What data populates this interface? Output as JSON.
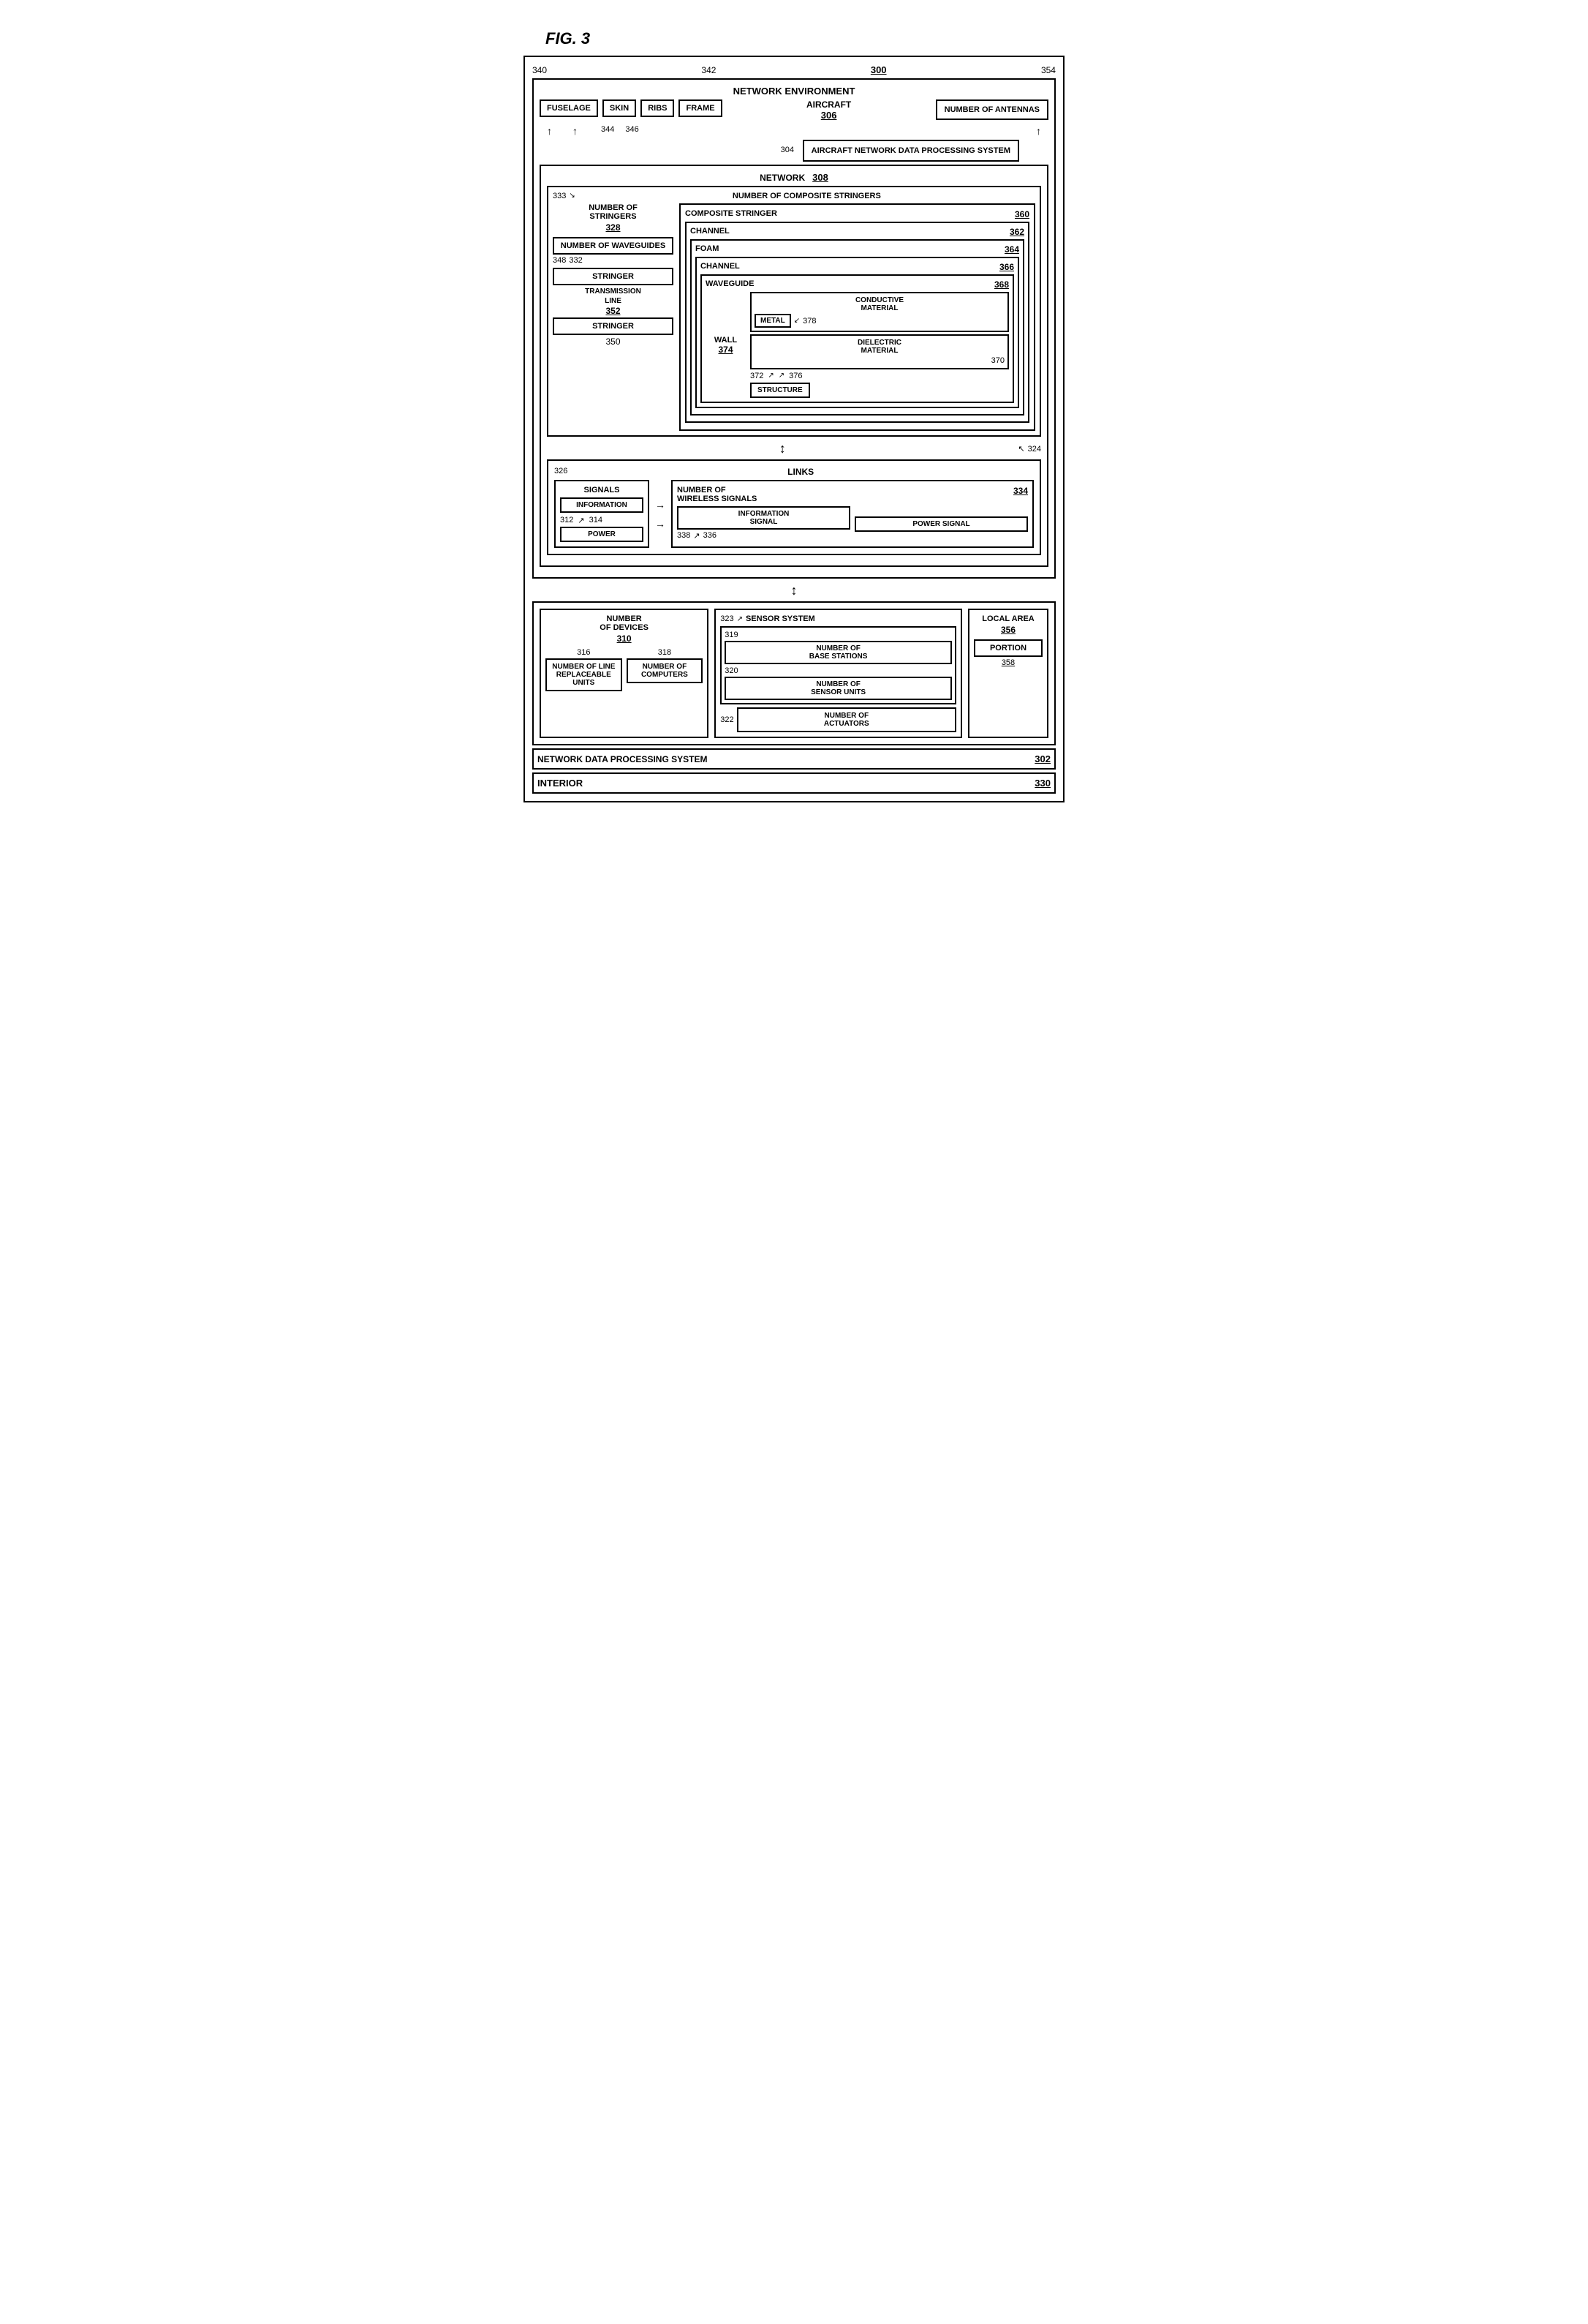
{
  "fig": {
    "title": "FIG. 3"
  },
  "refs": {
    "r300": "300",
    "r302": "302",
    "r304": "304",
    "r306": "306",
    "r308": "308",
    "r310": "310",
    "r312": "312",
    "r314": "314",
    "r316": "316",
    "r318": "318",
    "r319": "319",
    "r320": "320",
    "r322": "322",
    "r323": "323",
    "r324": "324",
    "r326": "326",
    "r328": "328",
    "r330": "330",
    "r332": "332",
    "r333": "333",
    "r334": "334",
    "r336": "336",
    "r338": "338",
    "r340": "340",
    "r342": "342",
    "r344": "344",
    "r346": "346",
    "r348": "348",
    "r350": "350",
    "r352": "352",
    "r354": "354",
    "r356": "356",
    "r358": "358",
    "r360": "360",
    "r362": "362",
    "r364": "364",
    "r366": "366",
    "r368": "368",
    "r370": "370",
    "r372": "372",
    "r374": "374",
    "r376": "376",
    "r378": "378"
  },
  "labels": {
    "network_environment": "NETWORK ENVIRONMENT",
    "aircraft": "AIRCRAFT",
    "fuselage": "FUSELAGE",
    "skin": "SKIN",
    "ribs": "RIBS",
    "frame": "FRAME",
    "number_of_antennas": "NUMBER OF ANTENNAS",
    "aircraft_ndps": "AIRCRAFT NETWORK DATA PROCESSING SYSTEM",
    "network": "NETWORK",
    "number_of_composite_stringers": "NUMBER OF COMPOSITE STRINGERS",
    "number_of_stringers": "NUMBER OF\nSTRINGERS",
    "composite_stringer": "COMPOSITE STRINGER",
    "channel1": "CHANNEL",
    "foam": "FOAM",
    "channel2": "CHANNEL",
    "waveguide": "WAVEGUIDE",
    "conductive_material": "CONDUCTIVE\nMATERIAL",
    "metal": "METAL",
    "dielectric_material": "DIELECTRIC\nMATERIAL",
    "wall": "WALL",
    "structure": "STRUCTURE",
    "number_of_waveguides": "NUMBER OF\nWAVEGUIDES",
    "stringer1": "STRINGER",
    "transmission_line": "TRANSMISSION\nLINE",
    "stringer2": "STRINGER",
    "links": "LINKS",
    "signals": "SIGNALS",
    "information": "INFORMATION",
    "power": "POWER",
    "number_of_wireless_signals": "NUMBER OF\nWIRELESS SIGNALS",
    "information_signal": "INFORMATION\nSIGNAL",
    "power_signal": "POWER SIGNAL",
    "number_of_devices": "NUMBER\nOF DEVICES",
    "sensor_system": "SENSOR SYSTEM",
    "number_of_line_replaceable_units": "NUMBER OF LINE\nREPLACEABLE UNITS",
    "number_of_computers": "NUMBER OF\nCOMPUTERS",
    "number_of_base_stations": "NUMBER OF\nBASE STATIONS",
    "number_of_sensor_units": "NUMBER OF\nSENSOR UNITS",
    "number_of_actuators": "NUMBER OF\nACTUATORS",
    "local_area": "LOCAL AREA",
    "portion": "PORTION",
    "network_data_processing_system": "NETWORK DATA PROCESSING SYSTEM",
    "interior": "INTERIOR"
  }
}
